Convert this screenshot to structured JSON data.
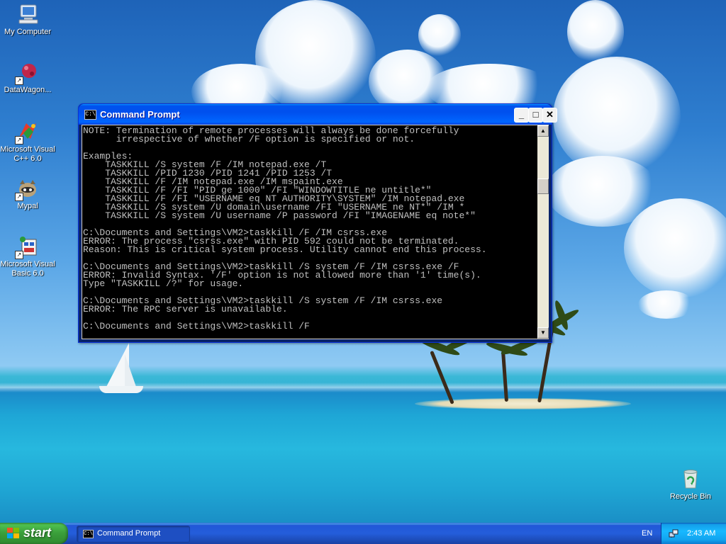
{
  "desktop": {
    "icons": [
      {
        "label": "My Computer"
      },
      {
        "label": "DataWagon..."
      },
      {
        "label": "Microsoft Visual C++ 6.0"
      },
      {
        "label": "Mypal"
      },
      {
        "label": "Microsoft Visual Basic 6.0"
      },
      {
        "label": "Recycle Bin"
      }
    ]
  },
  "window": {
    "title": "Command Prompt",
    "icon_text": "C:\\",
    "buttons": {
      "minimize": "_",
      "maximize": "□",
      "close": "✕"
    },
    "console_text": "NOTE: Termination of remote processes will always be done forcefully\n      irrespective of whether /F option is specified or not.\n\nExamples:\n    TASKKILL /S system /F /IM notepad.exe /T\n    TASKKILL /PID 1230 /PID 1241 /PID 1253 /T\n    TASKKILL /F /IM notepad.exe /IM mspaint.exe\n    TASKKILL /F /FI \"PID ge 1000\" /FI \"WINDOWTITLE ne untitle*\"\n    TASKKILL /F /FI \"USERNAME eq NT AUTHORITY\\SYSTEM\" /IM notepad.exe\n    TASKKILL /S system /U domain\\username /FI \"USERNAME ne NT*\" /IM *\n    TASKKILL /S system /U username /P password /FI \"IMAGENAME eq note*\"\n\nC:\\Documents and Settings\\VM2>taskkill /F /IM csrss.exe\nERROR: The process \"csrss.exe\" with PID 592 could not be terminated.\nReason: This is critical system process. Utility cannot end this process.\n\nC:\\Documents and Settings\\VM2>taskkill /S system /F /IM csrss.exe /F\nERROR: Invalid Syntax. '/F' option is not allowed more than '1' time(s).\nType \"TASKKILL /?\" for usage.\n\nC:\\Documents and Settings\\VM2>taskkill /S system /F /IM csrss.exe\nERROR: The RPC server is unavailable.\n\nC:\\Documents and Settings\\VM2>taskkill /F",
    "scroll": {
      "up": "▲",
      "down": "▼"
    }
  },
  "taskbar": {
    "start_label": "start",
    "tasks": [
      {
        "label": "Command Prompt",
        "icon_text": "C:\\"
      }
    ],
    "language": "EN",
    "clock": "2:43 AM"
  },
  "colors": {
    "console_bg": "#000000",
    "console_fg": "#c0c0c0",
    "titlebar": "#0054e3",
    "taskbar": "#245edb",
    "start_button": "#3a9e3a"
  }
}
